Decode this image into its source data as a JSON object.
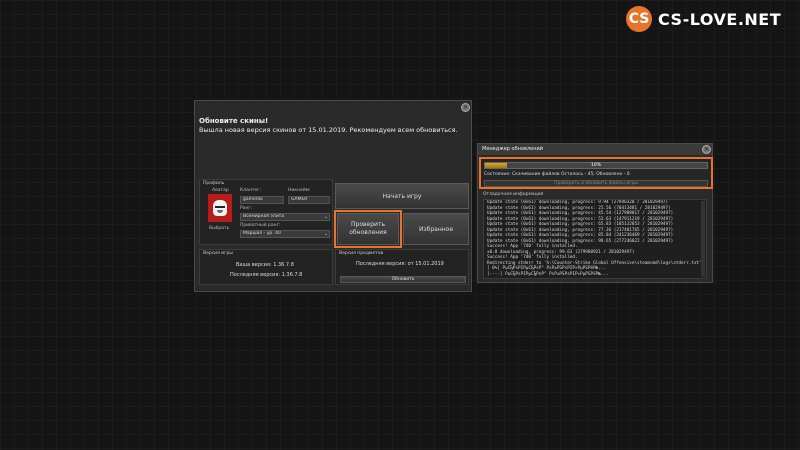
{
  "logo": {
    "badge": "CS",
    "text": "CS-LOVE.NET"
  },
  "main_window": {
    "close": "×",
    "update_title": "Обновите скины!",
    "update_message": "Вышла новая версия скинов от 15.01.2019. Рекомендуем всем обновиться.",
    "profile": {
      "section": "Профиль",
      "avatar_label": "Аватар",
      "select_button": "Выбрать",
      "clantag_label": "Клантег:",
      "clantag_value": "gamerok",
      "nickname_label": "Никнейм:",
      "nickname_value": "GAMER",
      "rank_label": "Ранг:",
      "rank_value": "Всемирная элита",
      "private_rank_label": "Приватный ранг:",
      "private_rank_value": "Маршал - ур. 40"
    },
    "buttons": {
      "start": "Начать игру",
      "check_updates_1": "Проверить",
      "check_updates_2": "обновления",
      "favorites": "Избранное",
      "update": "Обновить"
    },
    "game_version": {
      "section": "Версия игры",
      "yours": "Ваша версия: 1.36.7.8",
      "latest": "Последняя версия: 1.36.7.8"
    },
    "skins_version": {
      "section": "Версия предметов",
      "latest": "Последняя версия: от 15.01.2019"
    }
  },
  "updater": {
    "title": "Менеджер обновлений",
    "close": "×",
    "progress_percent": 0.1,
    "progress_text": "10%",
    "state_line": "Состояние: Скачивание файлов Осталось - 45; Обновлено - 0.",
    "verify_button": "Проверить и обновить файлы игры",
    "debug_title": "Отладочная информация",
    "log": [
      "Update state (0x61) downloading, progress: 9.94 (27946320 / 281029497)",
      "Update state (0x61) downloading, progress: 25.56 (70413481 / 281029497)",
      "Update state (0x61) downloading, progress: 45.54 (127988817 / 281029497)",
      "Update state (0x61) downloading, progress: 52.63 (147911219 / 281029497)",
      "Update state (0x61) downloading, progress: 65.83 (185132853 / 281029497)",
      "Update state (0x61) downloading, progress: 77.36 (217401765 / 281029497)",
      "Update state (0x61) downloading, progress: 85.84 (241236469 / 281029497)",
      "Update state (0x61) downloading, progress: 98.65 (277246022 / 281029497)",
      "Success! App '740' fully installed.",
      "x0.0 downloading, progress: 99.63 (279980921 / 281029497)",
      "Success! App '740' fully installed.",
      "Redirecting stderr to 'h:\\Counter-Strike Global Offensive\\steamcmd\\logs\\stderr.txt'",
      "[ 0%] РџСЂРѕРІРµСЂРєР° РѕР±РЅРѕРІР»РµРЅРёР№...",
      "[----] РџСЂРѕРІРµСЂРєР° РѕР±РЅРѕРІР»РµРЅРёР№..."
    ]
  }
}
